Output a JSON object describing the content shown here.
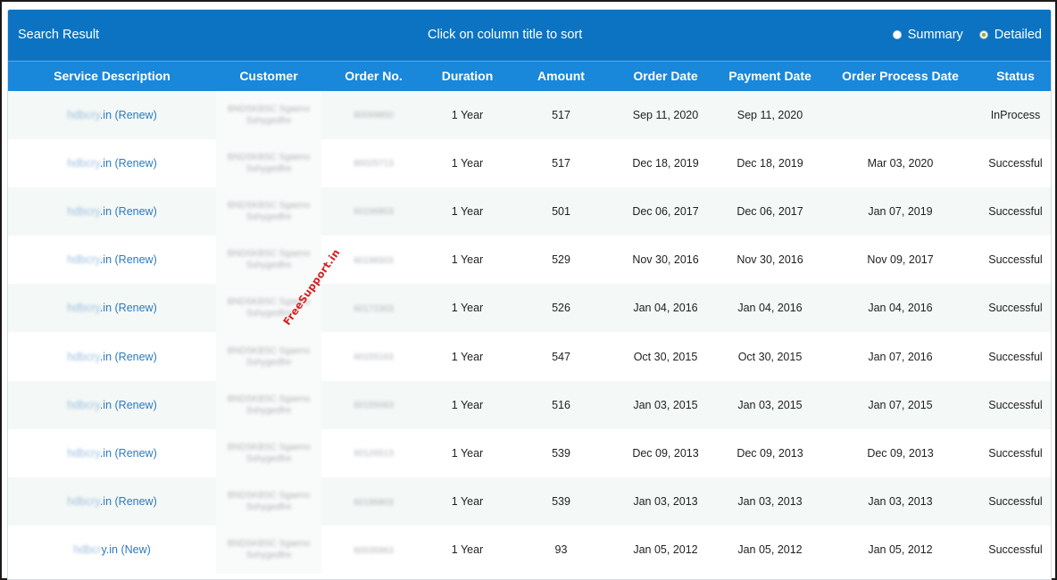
{
  "header": {
    "title": "Search Result",
    "hint": "Click on column title to sort",
    "view_options": [
      {
        "label": "Summary",
        "selected": false
      },
      {
        "label": "Detailed",
        "selected": true
      }
    ]
  },
  "columns": [
    "Service Description",
    "Customer",
    "Order No.",
    "Duration",
    "Amount",
    "Order Date",
    "Payment Date",
    "Order Process Date",
    "Status"
  ],
  "rows": [
    {
      "service_prefix": "hdbcry",
      "service_suffix": ".in (Renew)",
      "customer_line1": "BNDSKBSC Sgaeno",
      "customer_line2": "Sshygedfre",
      "order_no": "80099850",
      "duration": "1 Year",
      "amount": "517",
      "order_date": "Sep 11, 2020",
      "payment_date": "Sep 11, 2020",
      "process_date": "",
      "status": "InProcess"
    },
    {
      "service_prefix": "hdbcry",
      "service_suffix": ".in (Renew)",
      "customer_line1": "BNDSKBSC Sgaeno",
      "customer_line2": "Sshygedfre",
      "order_no": "80025713",
      "duration": "1 Year",
      "amount": "517",
      "order_date": "Dec 18, 2019",
      "payment_date": "Dec 18, 2019",
      "process_date": "Mar 03, 2020",
      "status": "Successful"
    },
    {
      "service_prefix": "hdbcry",
      "service_suffix": ".in (Renew)",
      "customer_line1": "BNDSKBSC Sgaeno",
      "customer_line2": "Sshygedfre",
      "order_no": "60196803",
      "duration": "1 Year",
      "amount": "501",
      "order_date": "Dec 06, 2017",
      "payment_date": "Dec 06, 2017",
      "process_date": "Jan 07, 2019",
      "status": "Successful"
    },
    {
      "service_prefix": "hdbcry",
      "service_suffix": ".in (Renew)",
      "customer_line1": "BNDSKBSC Sgaeno",
      "customer_line2": "Sshygedfre",
      "order_no": "60196503",
      "duration": "1 Year",
      "amount": "529",
      "order_date": "Nov 30, 2016",
      "payment_date": "Nov 30, 2016",
      "process_date": "Nov 09, 2017",
      "status": "Successful"
    },
    {
      "service_prefix": "hdbcry",
      "service_suffix": ".in (Renew)",
      "customer_line1": "BNDSKBSC Sgaeno",
      "customer_line2": "Sshygedfre",
      "order_no": "60172303",
      "duration": "1 Year",
      "amount": "526",
      "order_date": "Jan 04, 2016",
      "payment_date": "Jan 04, 2016",
      "process_date": "Jan 04, 2016",
      "status": "Successful"
    },
    {
      "service_prefix": "hdbcry",
      "service_suffix": ".in (Renew)",
      "customer_line1": "BNDSKBSC Sgaeno",
      "customer_line2": "Sshygedfre",
      "order_no": "60155163",
      "duration": "1 Year",
      "amount": "547",
      "order_date": "Oct 30, 2015",
      "payment_date": "Oct 30, 2015",
      "process_date": "Jan 07, 2016",
      "status": "Successful"
    },
    {
      "service_prefix": "hdbcry",
      "service_suffix": ".in (Renew)",
      "customer_line1": "BNDSKBSC Sgaeno",
      "customer_line2": "Sshygedfre",
      "order_no": "60155063",
      "duration": "1 Year",
      "amount": "516",
      "order_date": "Jan 03, 2015",
      "payment_date": "Jan 03, 2015",
      "process_date": "Jan 07, 2015",
      "status": "Successful"
    },
    {
      "service_prefix": "hdbcry",
      "service_suffix": ".in (Renew)",
      "customer_line1": "BNDSKBSC Sgaeno",
      "customer_line2": "Sshygedfre",
      "order_no": "60126513",
      "duration": "1 Year",
      "amount": "539",
      "order_date": "Dec 09, 2013",
      "payment_date": "Dec 09, 2013",
      "process_date": "Dec 09, 2013",
      "status": "Successful"
    },
    {
      "service_prefix": "hdbcry",
      "service_suffix": ".in (Renew)",
      "customer_line1": "BNDSKBSC Sgaeno",
      "customer_line2": "Sshygedfre",
      "order_no": "60196803",
      "duration": "1 Year",
      "amount": "539",
      "order_date": "Jan 03, 2013",
      "payment_date": "Jan 03, 2013",
      "process_date": "Jan 03, 2013",
      "status": "Successful"
    },
    {
      "service_prefix": "hdbcr",
      "service_suffix": "y.in (New)",
      "customer_line1": "BNDSKBSC Sgaeno",
      "customer_line2": "Sshygedfre",
      "order_no": "60035963",
      "duration": "1 Year",
      "amount": "93",
      "order_date": "Jan 05, 2012",
      "payment_date": "Jan 05, 2012",
      "process_date": "Jan 05, 2012",
      "status": "Successful"
    }
  ],
  "watermark": "FreeSupport.in"
}
